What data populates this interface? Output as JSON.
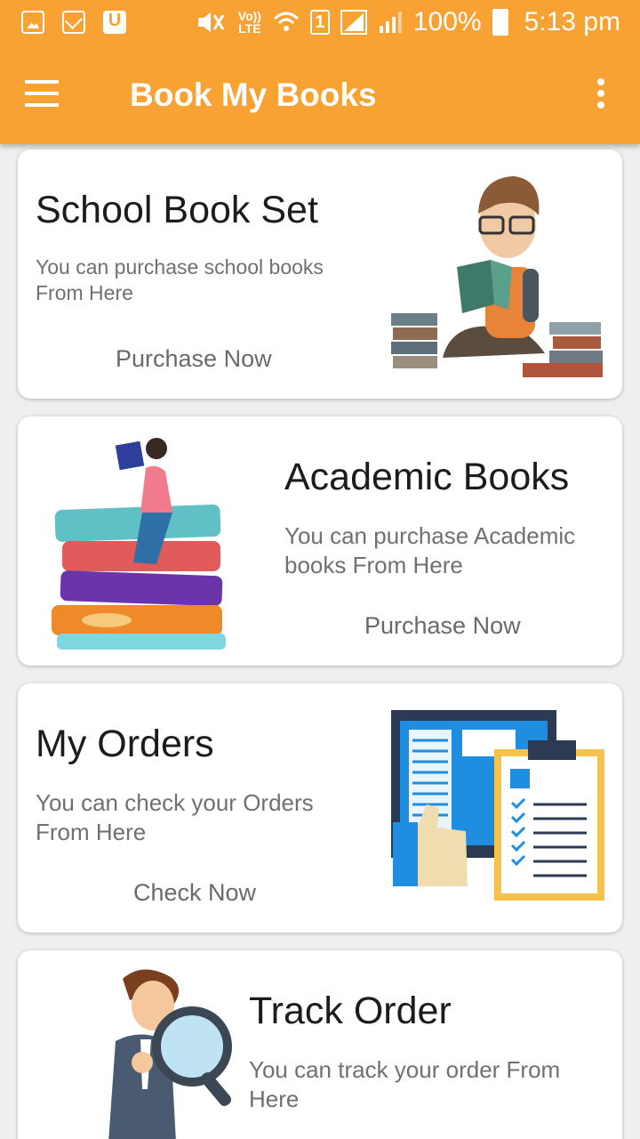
{
  "status_bar": {
    "time": "5:13 pm",
    "battery": "100%",
    "volte": "Vo)) LTE",
    "sim": "1",
    "left_icons": [
      "image-icon",
      "mail-icon",
      "u-app-icon"
    ],
    "right_icons": [
      "mute-icon",
      "volte-icon",
      "wifi-icon",
      "sim-1-icon",
      "signal-icon",
      "signal-icon",
      "battery-icon"
    ]
  },
  "toolbar": {
    "title": "Book My Books",
    "menu_icon": "hamburger-menu-icon",
    "overflow_icon": "more-vert-icon",
    "accent_color": "#f7a233"
  },
  "cards": [
    {
      "title": "School Book Set",
      "description": "You can purchase school books From Here",
      "action": "Purchase Now",
      "illustration": "boy-reading-on-books"
    },
    {
      "title": "Academic Books",
      "description": "You can purchase Academic books From Here",
      "action": "Purchase Now",
      "illustration": "girl-on-book-stack"
    },
    {
      "title": "My Orders",
      "description": "You can check your Orders From Here",
      "action": "Check Now",
      "illustration": "monitor-clipboard-checklist"
    },
    {
      "title": "Track Order",
      "description": "You can track your order From Here",
      "illustration": "man-with-magnifier"
    }
  ]
}
